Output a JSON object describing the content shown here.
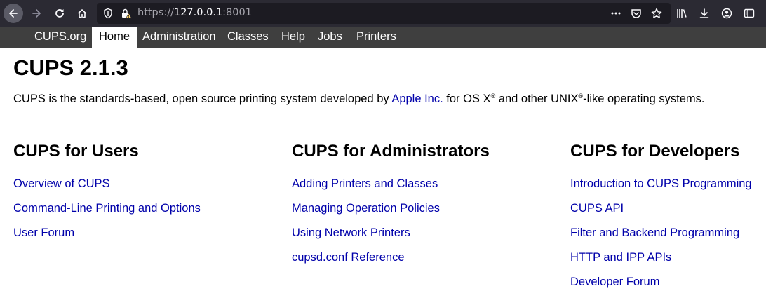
{
  "browser": {
    "url_scheme": "https://",
    "url_host": "127.0.0.1",
    "url_port": ":8001"
  },
  "nav": {
    "items": [
      {
        "label": "CUPS.org"
      },
      {
        "label": "Home"
      },
      {
        "label": "Administration"
      },
      {
        "label": "Classes"
      },
      {
        "label": "Help"
      },
      {
        "label": "Jobs"
      },
      {
        "label": "Printers"
      }
    ],
    "active": "Home"
  },
  "page": {
    "title": "CUPS 2.1.3",
    "intro_before": "CUPS is the standards-based, open source printing system developed by ",
    "intro_link": "Apple Inc.",
    "intro_middle": " for OS X",
    "intro_reg1": "®",
    "intro_and": " and other UNIX",
    "intro_reg2": "®",
    "intro_after": "-like operating systems."
  },
  "columns": [
    {
      "heading": "CUPS for Users",
      "links": [
        "Overview of CUPS",
        "Command-Line Printing and Options",
        "User Forum"
      ]
    },
    {
      "heading": "CUPS for Administrators",
      "links": [
        "Adding Printers and Classes",
        "Managing Operation Policies",
        "Using Network Printers",
        "cupsd.conf Reference"
      ]
    },
    {
      "heading": "CUPS for Developers",
      "links": [
        "Introduction to CUPS Programming",
        "CUPS API",
        "Filter and Backend Programming",
        "HTTP and IPP APIs",
        "Developer Forum"
      ]
    }
  ],
  "colors": {
    "toolbar_bg": "#2b2a33",
    "navbar_bg": "#3f3f3f",
    "link": "#0000aa"
  }
}
